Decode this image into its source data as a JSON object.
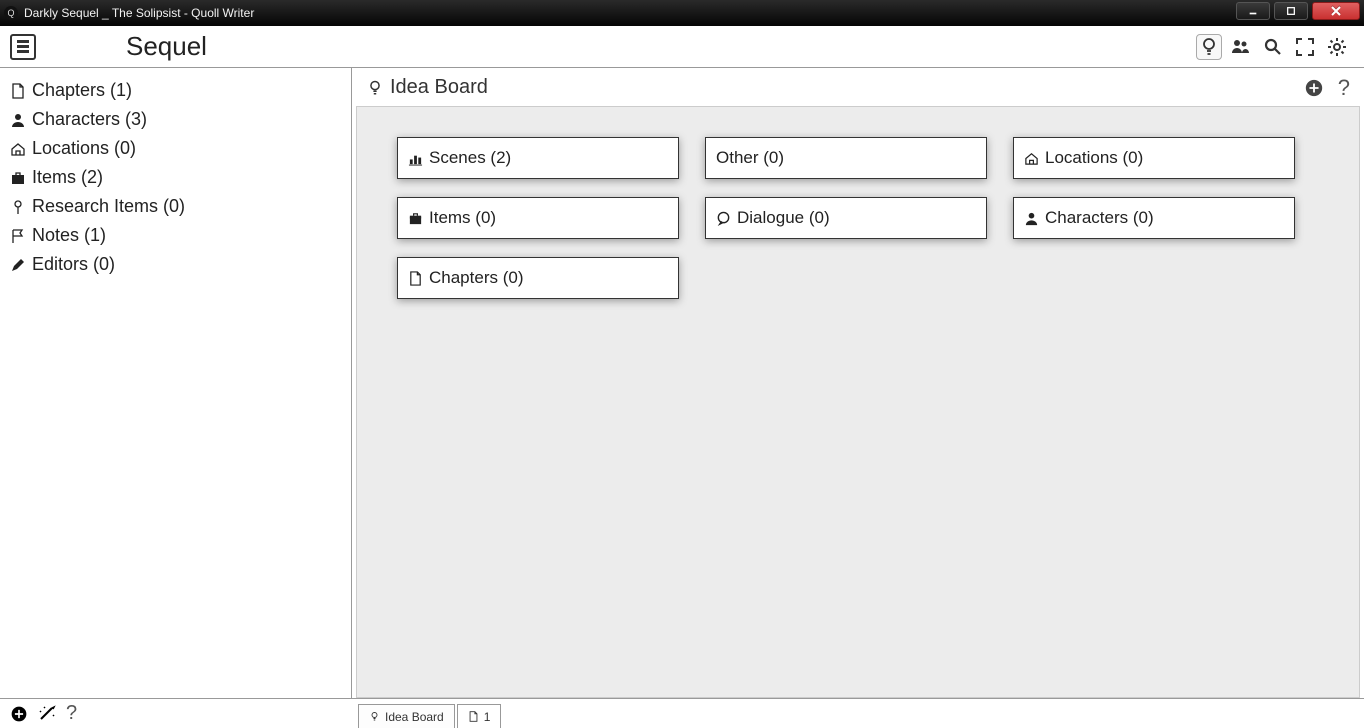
{
  "window_title": "Darkly Sequel _ The Solipsist - Quoll Writer",
  "project_title": "Sequel",
  "sidebar": {
    "items": [
      {
        "icon": "doc",
        "label": "Chapters (1)"
      },
      {
        "icon": "person",
        "label": "Characters (3)"
      },
      {
        "icon": "home",
        "label": "Locations (0)"
      },
      {
        "icon": "briefcase",
        "label": "Items (2)"
      },
      {
        "icon": "pin",
        "label": "Research Items (0)"
      },
      {
        "icon": "flag",
        "label": "Notes (1)"
      },
      {
        "icon": "pencil",
        "label": "Editors (0)"
      }
    ]
  },
  "ideaboard": {
    "title": "Idea Board",
    "cards": [
      {
        "icon": "chart",
        "label": "Scenes (2)"
      },
      {
        "icon": "",
        "label": "Other (0)"
      },
      {
        "icon": "home",
        "label": "Locations (0)"
      },
      {
        "icon": "briefcase",
        "label": "Items (0)"
      },
      {
        "icon": "speech",
        "label": "Dialogue (0)"
      },
      {
        "icon": "person",
        "label": "Characters (0)"
      },
      {
        "icon": "doc",
        "label": "Chapters (0)"
      }
    ]
  },
  "tabs": [
    {
      "icon": "idea",
      "label": "Idea Board"
    },
    {
      "icon": "doc",
      "label": "1"
    }
  ]
}
